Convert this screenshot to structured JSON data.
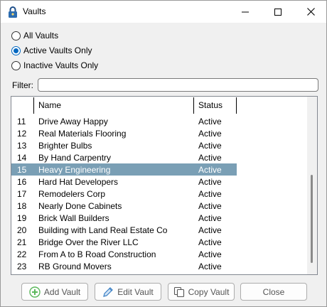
{
  "window": {
    "title": "Vaults",
    "minimize_icon": "minimize-icon",
    "maximize_icon": "maximize-icon",
    "close_icon": "close-icon",
    "app_icon": "padlock-icon"
  },
  "filters": {
    "options": [
      {
        "label": "All Vaults",
        "checked": false
      },
      {
        "label": "Active Vaults Only",
        "checked": true
      },
      {
        "label": "Inactive Vaults Only",
        "checked": false
      }
    ],
    "filter_label": "Filter:",
    "filter_value": ""
  },
  "table": {
    "columns": [
      "Name",
      "Status"
    ],
    "rows": [
      {
        "id": "11",
        "name": "Drive Away Happy",
        "status": "Active",
        "selected": false
      },
      {
        "id": "12",
        "name": "Real Materials Flooring",
        "status": "Active",
        "selected": false
      },
      {
        "id": "13",
        "name": "Brighter Bulbs",
        "status": "Active",
        "selected": false
      },
      {
        "id": "14",
        "name": "By Hand Carpentry",
        "status": "Active",
        "selected": false
      },
      {
        "id": "15",
        "name": "Heavy Engineering",
        "status": "Active",
        "selected": true
      },
      {
        "id": "16",
        "name": "Hard Hat Developers",
        "status": "Active",
        "selected": false
      },
      {
        "id": "17",
        "name": "Remodelers Corp",
        "status": "Active",
        "selected": false
      },
      {
        "id": "18",
        "name": "Nearly Done Cabinets",
        "status": "Active",
        "selected": false
      },
      {
        "id": "19",
        "name": "Brick Wall Builders",
        "status": "Active",
        "selected": false
      },
      {
        "id": "20",
        "name": "Building with Land Real Estate Co",
        "status": "Active",
        "selected": false
      },
      {
        "id": "21",
        "name": "Bridge Over the River LLC",
        "status": "Active",
        "selected": false
      },
      {
        "id": "22",
        "name": "From A to B Road Construction",
        "status": "Active",
        "selected": false
      },
      {
        "id": "23",
        "name": "RB Ground Movers",
        "status": "Active",
        "selected": false
      }
    ],
    "selection_color": "#7a9fb5"
  },
  "buttons": {
    "add_vault": {
      "label": "Add Vault",
      "icon": "plus-circle-icon"
    },
    "edit_vault": {
      "label": "Edit Vault",
      "icon": "pencil-icon"
    },
    "copy_vault": {
      "label": "Copy Vault",
      "icon": "copy-icon"
    },
    "close": {
      "label": "Close"
    }
  },
  "colors": {
    "accent": "#0067c0",
    "add_icon": "#5cb85c",
    "edit_icon": "#3a7fc4"
  }
}
